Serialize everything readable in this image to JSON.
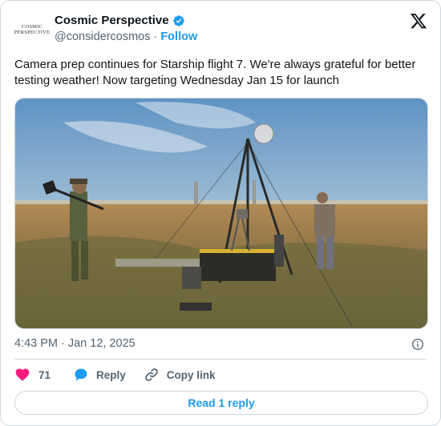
{
  "author": {
    "logo_text_line1": "COSMIC",
    "logo_text_line2": "PERSPECTIVE",
    "display_name": "Cosmic Perspective",
    "handle": "@considercosmos",
    "separator": "·",
    "follow_label": "Follow",
    "verified_color": "#1d9bf0"
  },
  "post": {
    "text": "Camera prep continues for Starship flight 7. We're always grateful for better testing weather! Now targeting Wednesday Jan 15 for launch",
    "media_icon": "photo-of-camera-setup",
    "time": "4:43 PM",
    "date_separator": "·",
    "date": "Jan 12, 2025"
  },
  "actions": {
    "like_count": "71",
    "reply_label": "Reply",
    "copy_link_label": "Copy link",
    "like_color": "#f91880",
    "reply_color": "#1d9bf0"
  },
  "read_reply_label": "Read 1 reply",
  "colors": {
    "accent": "#1d9bf0",
    "secondary_text": "#536471",
    "border": "#cfd9de"
  }
}
